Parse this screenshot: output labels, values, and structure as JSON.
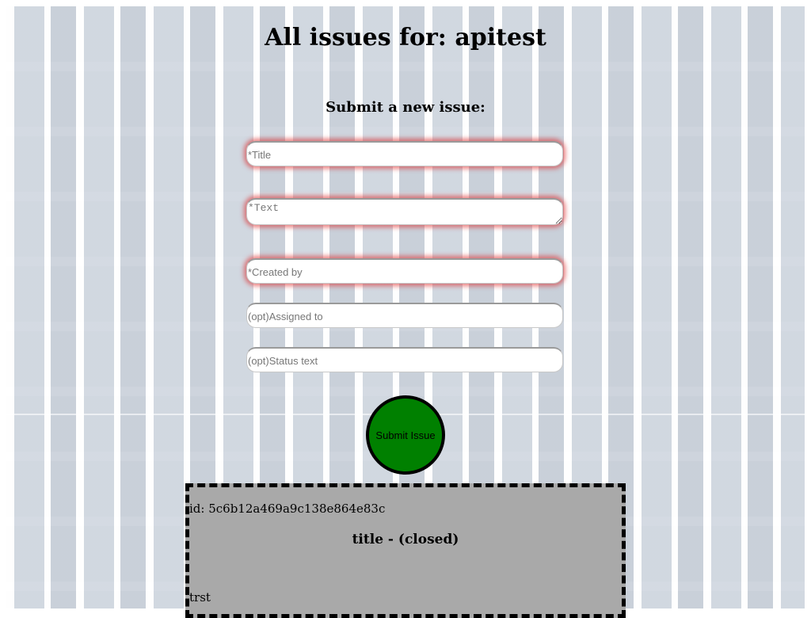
{
  "header": {
    "title": "All issues for: apitest"
  },
  "form": {
    "heading": "Submit a new issue:",
    "fields": {
      "title_placeholder": "*Title",
      "text_placeholder": "*Text",
      "created_by_placeholder": "*Created by",
      "assigned_to_placeholder": "(opt)Assigned to",
      "status_text_placeholder": "(opt)Status text"
    },
    "submit_label": "Submit Issue"
  },
  "issues": [
    {
      "id_line": "id: 5c6b12a469a9c138e864e83c",
      "title_line": "title - (closed)",
      "text": "trst"
    }
  ],
  "colors": {
    "submit_button": "#008000",
    "issue_card": "#a9a9a9",
    "required_glow": "#dc1e1e"
  }
}
